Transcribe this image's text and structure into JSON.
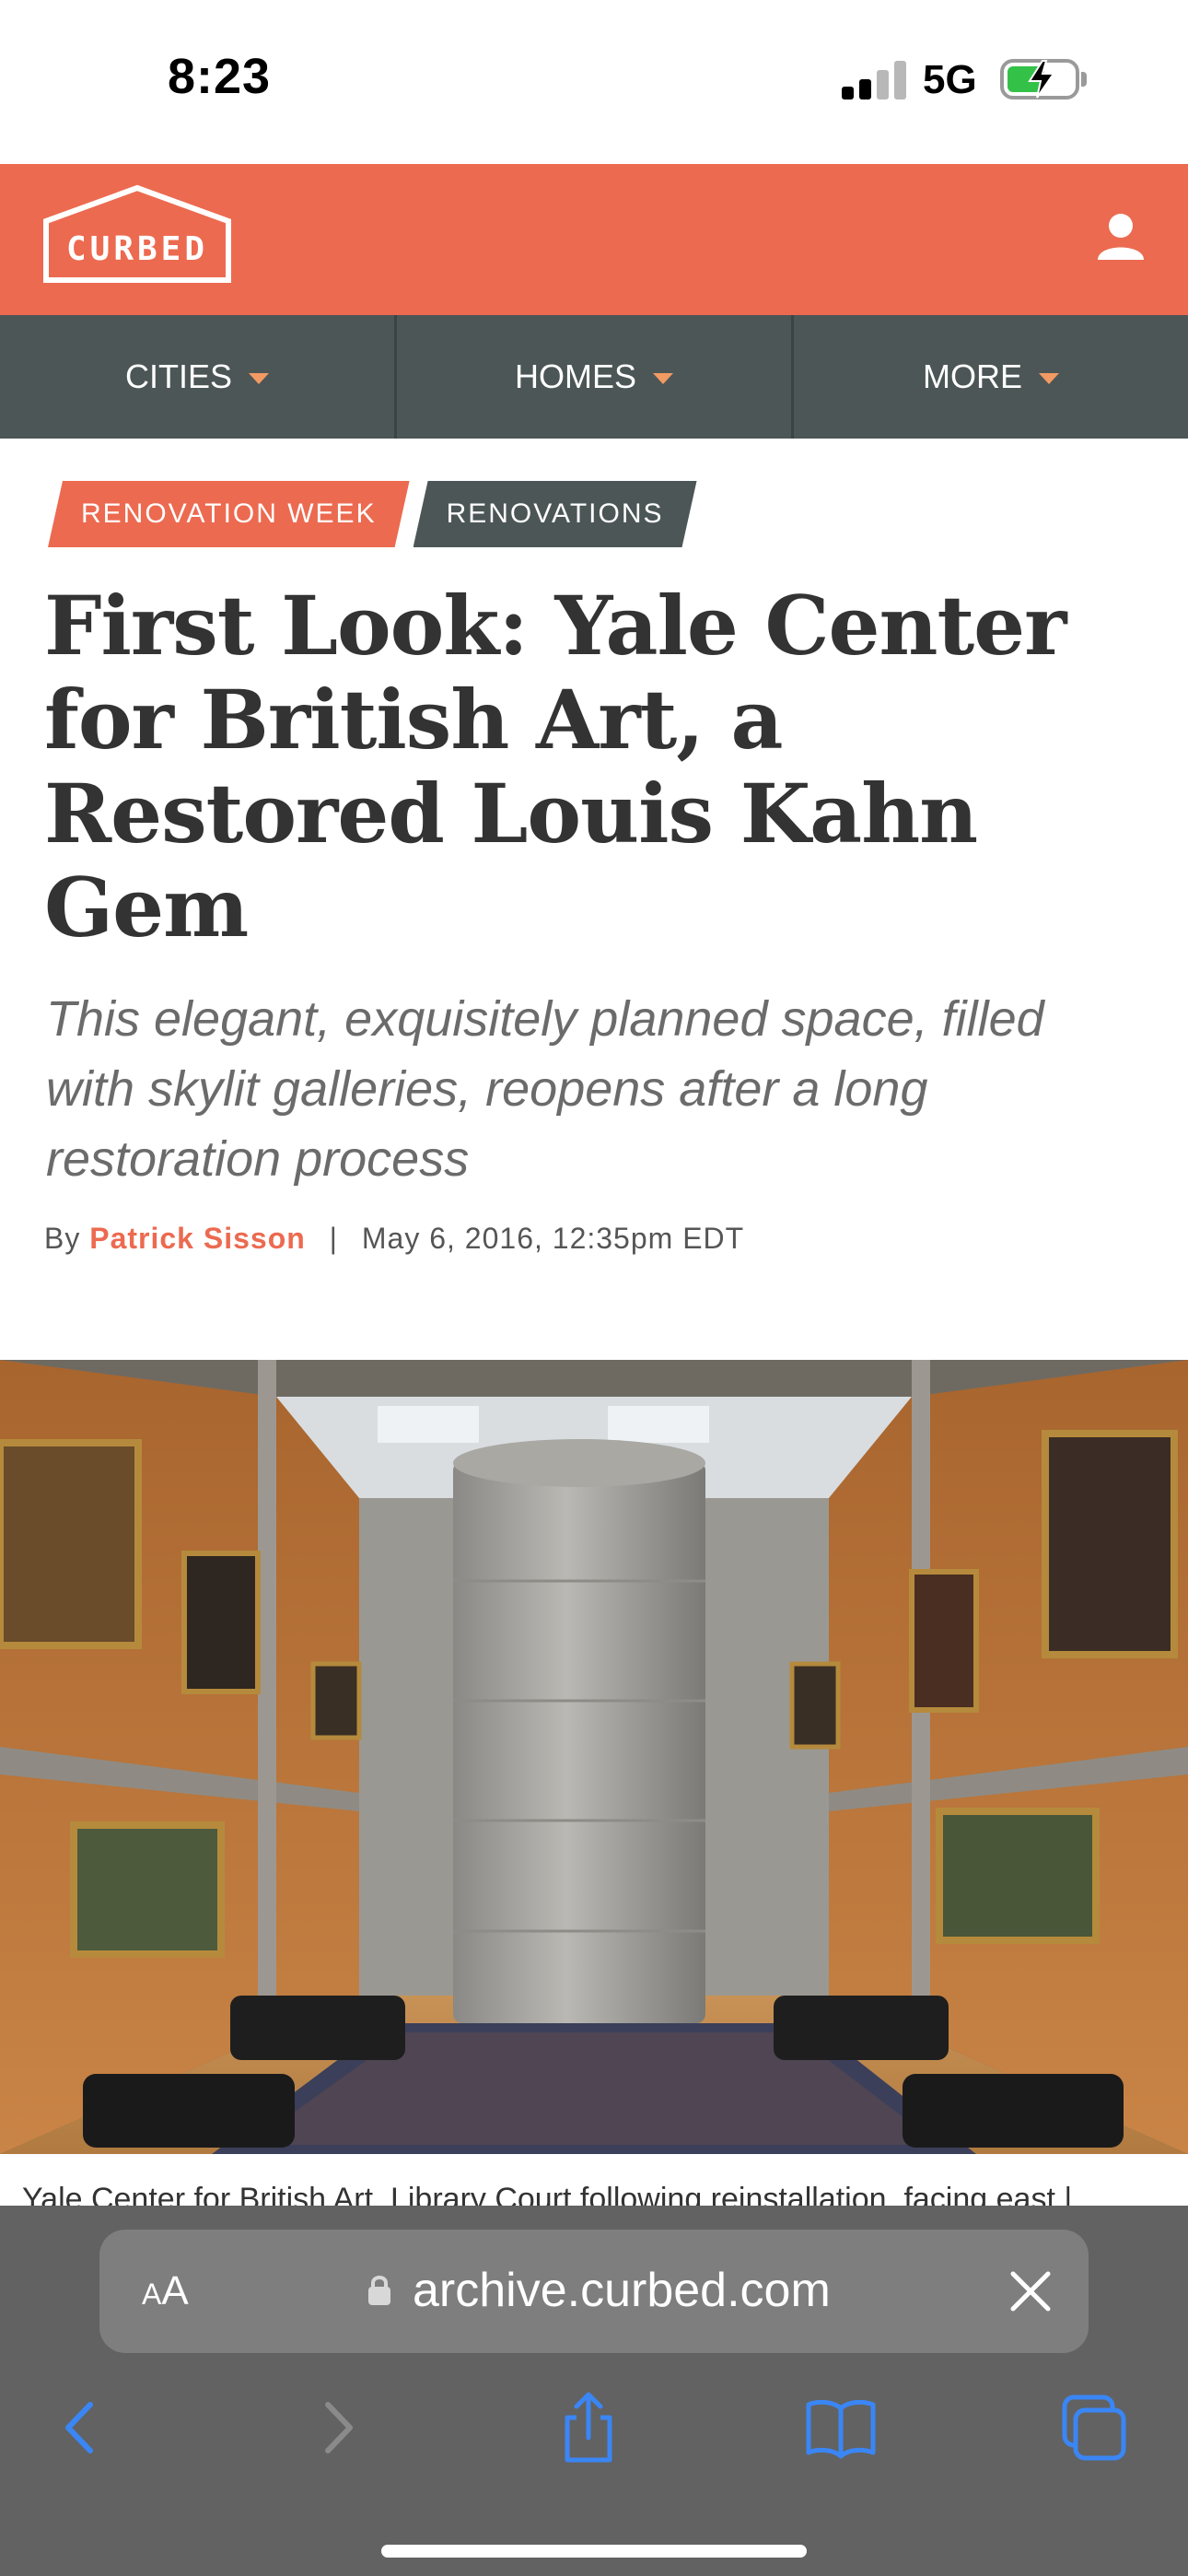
{
  "status_bar": {
    "time": "8:23",
    "network": "5G",
    "battery_level": 0.55,
    "signal_bars": 2
  },
  "header": {
    "logo_text": "CURBED",
    "account_icon": "user-icon"
  },
  "nav": {
    "items": [
      {
        "label": "CITIES"
      },
      {
        "label": "HOMES"
      },
      {
        "label": "MORE"
      }
    ]
  },
  "article": {
    "tags": [
      "RENOVATION WEEK",
      "RENOVATIONS"
    ],
    "headline": "First Look: Yale Center for British Art, a Restored Louis Kahn Gem",
    "dek": "This elegant, exquisitely planned space, filled with skylit galleries, reopens after a long restoration process",
    "byline_prefix": "By",
    "author": "Patrick Sisson",
    "byline_separator": "|",
    "date": "May 6, 2016, 12:35pm EDT",
    "caption": "Yale Center for British Art, Library Court following reinstallation, facing east |"
  },
  "browser": {
    "text_size_label_small": "A",
    "text_size_label_large": "A",
    "url": "archive.curbed.com",
    "toolbar_icons": [
      "back-icon",
      "forward-icon",
      "share-icon",
      "bookmarks-icon",
      "tabs-icon"
    ]
  },
  "colors": {
    "brand": "#ec6a50",
    "nav": "#4c5656",
    "link": "#3a86f5"
  }
}
